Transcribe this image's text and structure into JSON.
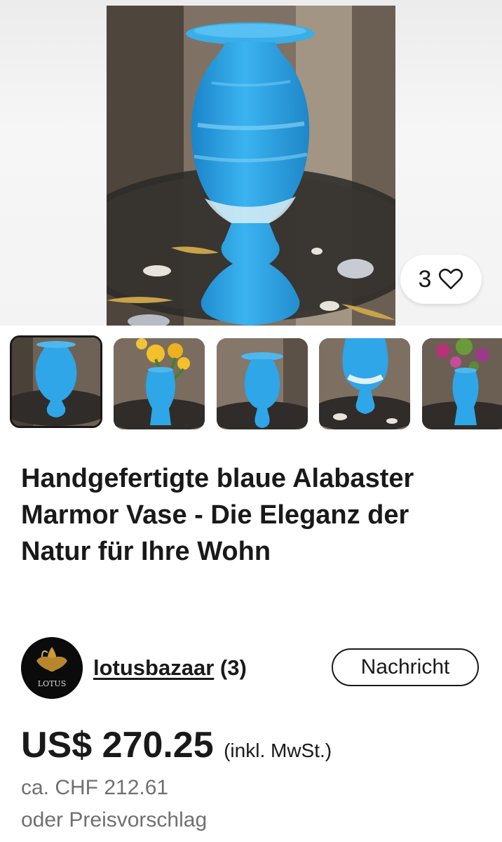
{
  "gallery": {
    "image_count": "3",
    "thumbnails": [
      {
        "id": "vase-front",
        "selected": true
      },
      {
        "id": "vase-with-flowers-yellow",
        "selected": false
      },
      {
        "id": "vase-side",
        "selected": false
      },
      {
        "id": "vase-closeup",
        "selected": false
      },
      {
        "id": "vase-with-flowers-purple",
        "selected": false
      }
    ]
  },
  "listing": {
    "title": "Handgefertigte blaue Alabaster Marmor Vase - Die Eleganz der Natur für Ihre Wohn"
  },
  "seller": {
    "name": "lotusbazaar",
    "rating": "(3)",
    "logo_text": "LOTUS",
    "message_button": "Nachricht"
  },
  "price": {
    "amount": "US$ 270.25",
    "tax_note": "(inkl. MwSt.)",
    "approx": "ca. CHF 212.61",
    "offer": "oder Preisvorschlag"
  },
  "icons": {
    "watch": "heart-outline-icon"
  },
  "colors": {
    "vase_blue": "#2fa3e6",
    "text": "#191919",
    "secondary_text": "#707070"
  }
}
